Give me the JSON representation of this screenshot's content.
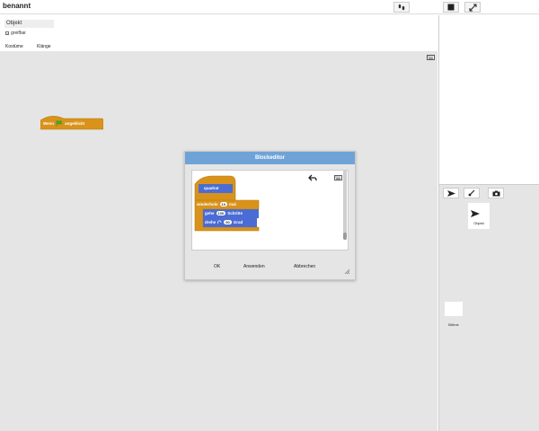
{
  "app": {
    "project_title": "benannt"
  },
  "sprite": {
    "name": "Objekt",
    "draggable_label": "greifbar"
  },
  "tabs": [
    {
      "label": "Kostüme"
    },
    {
      "label": "Klänge"
    }
  ],
  "script": {
    "hat_block_text_1": "Wenn",
    "hat_block_text_2": "angeklickt"
  },
  "dialog": {
    "title": "Blockeditor",
    "prototype_block": "quadrat",
    "repeat": {
      "label_1": "wiederhole",
      "value": "10",
      "label_2": "mal"
    },
    "move": {
      "label_1": "gehe",
      "value": "100",
      "label_2": "Schritte"
    },
    "turn": {
      "label_1": "drehe",
      "value": "90",
      "label_2": "Grad"
    },
    "buttons": {
      "ok": "OK",
      "apply": "Anwenden",
      "cancel": "Abbrechen"
    }
  },
  "corral": {
    "sprite_label": "Objekt",
    "stage_label": "Bühne"
  },
  "colors": {
    "control": "#d9931a",
    "motion": "#4a6cd4",
    "custom_block": "#4a6cd4",
    "dialog_title": "#6fa3d8",
    "flag": "#2eb82e"
  },
  "icons": [
    "footsteps-icon",
    "stop-square-icon",
    "fullscreen-icon",
    "undo-arrow-icon",
    "keyboard-icon",
    "turtle-arrow-icon",
    "paint-brush-icon",
    "camera-icon",
    "resize-handle-icon",
    "green-flag-icon",
    "turn-clockwise-icon"
  ]
}
